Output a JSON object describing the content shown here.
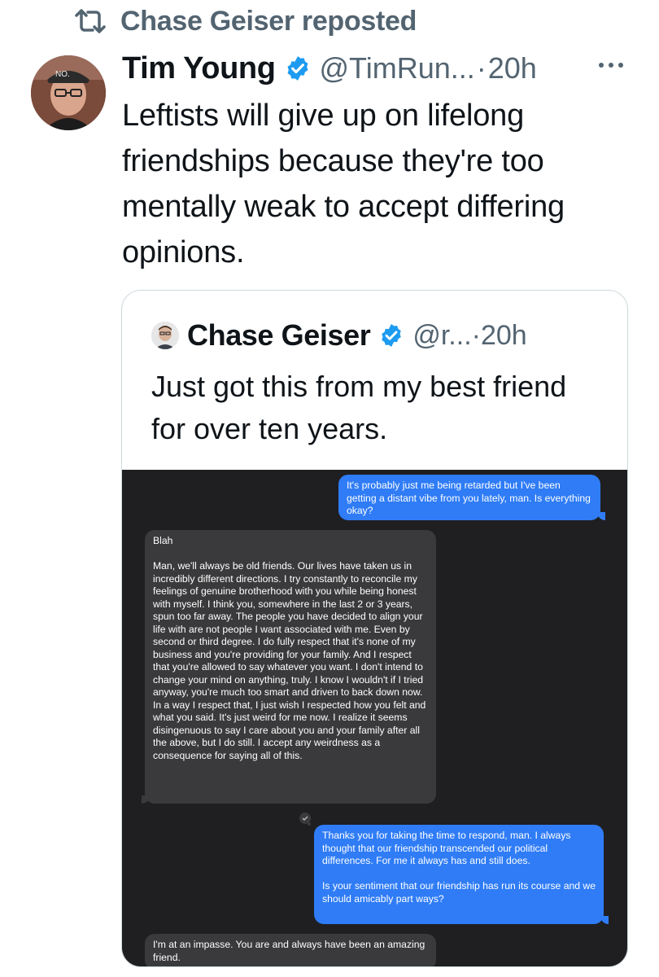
{
  "repost": {
    "label": "Chase Geiser reposted",
    "icon": "repost-icon"
  },
  "tweet": {
    "author_name": "Tim Young",
    "handle": "@TimRun...",
    "separator": "·",
    "time": "20h",
    "text": "Leftists will give up on lifelong friendships because they're too mentally weak to accept differing opinions.",
    "more_icon": "more-horizontal-icon",
    "verified_icon": "verified-badge-icon"
  },
  "quote": {
    "author_name": "Chase Geiser",
    "handle": "@r...",
    "separator": "·",
    "time": "20h",
    "text": "Just got this from my best friend for over ten years."
  },
  "messages": [
    {
      "side": "sent",
      "text": "It's probably just me being retarded but I've been getting a distant vibe from you lately, man. Is everything okay?"
    },
    {
      "side": "received",
      "text": "Blah\n\nMan, we'll always be old friends. Our lives have taken us in incredibly different directions. I try constantly to reconcile my  feelings of genuine brotherhood with you while being honest with myself. I think you, somewhere in the last 2 or 3 years, spun too far away. The people you have decided to align your life with are not people I want associated with me. Even by second or third degree. I do fully respect that it's none of my business and you're providing for your family. And I respect that you're allowed to say whatever you want. I don't intend to change your mind on anything, truly. I know I wouldn't if I tried anyway, you're much too smart and driven to back down now. In a way I respect that, I just wish I respected how you felt and what you said. It's just weird for me now. I realize it seems disingenuous to say I care about you and your family after all the above, but I do still. I accept any weirdness as a consequence for saying all of this."
    },
    {
      "side": "sent",
      "text": "Thanks you for taking the time to respond, man. I always thought that our friendship transcended our political differences. For me it always has and still does.\n\nIs your sentiment that our friendship has run its course and we should amicably part ways?"
    },
    {
      "side": "received",
      "text": "I'm at an impasse. You are and always have been an amazing friend."
    }
  ],
  "colors": {
    "sent_bubble": "#2f7cf6",
    "received_bubble": "#3a3a3c",
    "verified": "#1d9bf0",
    "muted": "#536471"
  }
}
